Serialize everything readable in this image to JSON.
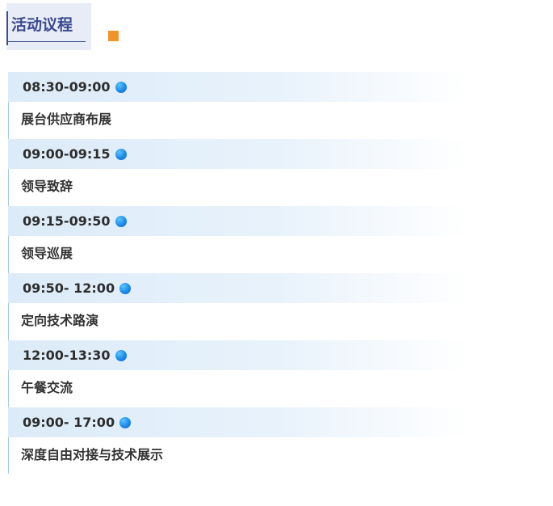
{
  "header": {
    "title": "活动议程"
  },
  "colors": {
    "title": "#3b4a8f",
    "accent": "#f0932b",
    "dot": "#1b8ae8",
    "time_bar": "#dcebf8"
  },
  "agenda": [
    {
      "time": "08:30-09:00",
      "desc": "展台供应商布展"
    },
    {
      "time": "09:00-09:15",
      "desc": "领导致辞"
    },
    {
      "time": "09:15-09:50",
      "desc": "领导巡展"
    },
    {
      "time": "09:50- 12:00",
      "desc": "定向技术路演"
    },
    {
      "time": "12:00-13:30",
      "desc": "午餐交流"
    },
    {
      "time": "09:00- 17:00",
      "desc": "深度自由对接与技术展示"
    }
  ]
}
